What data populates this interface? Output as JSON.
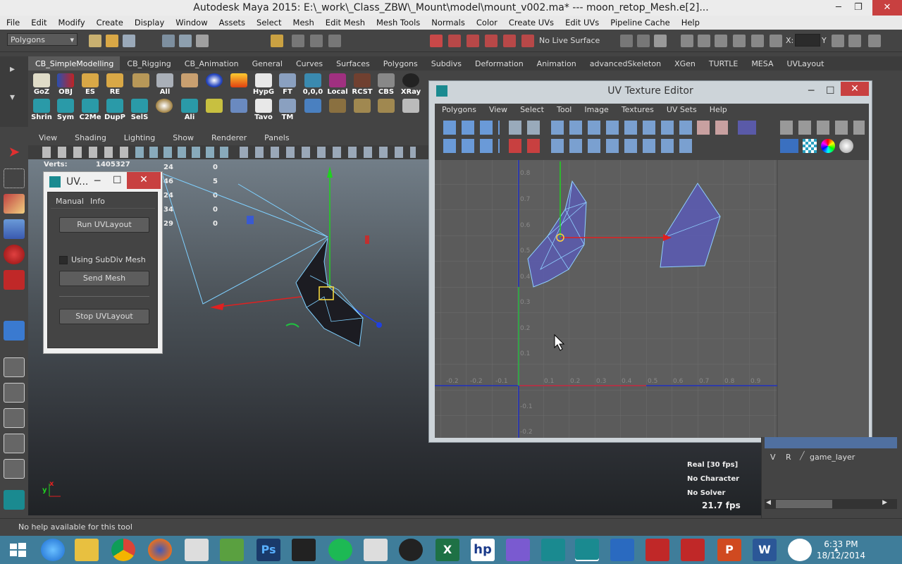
{
  "window": {
    "title": "Autodesk Maya 2015: E:\\_work\\_Class_ZBW\\_Mount\\model\\mount_v002.ma*   ---   moon_retop_Mesh.e[2]..."
  },
  "menubar": [
    "File",
    "Edit",
    "Modify",
    "Create",
    "Display",
    "Window",
    "Assets",
    "Select",
    "Mesh",
    "Edit Mesh",
    "Mesh Tools",
    "Normals",
    "Color",
    "Create UVs",
    "Edit UVs",
    "Pipeline Cache",
    "Help"
  ],
  "statusline": {
    "menuset": "Polygons",
    "live_surface": "No Live Surface",
    "x_label": "X:",
    "y_label": "Y"
  },
  "shelf_tabs": [
    "CB_SimpleModelling",
    "CB_Rigging",
    "CB_Animation",
    "General",
    "Curves",
    "Surfaces",
    "Polygons",
    "Subdivs",
    "Deformation",
    "Animation",
    "advancedSkeleton",
    "XGen",
    "TURTLE",
    "MESA",
    "UVLayout"
  ],
  "shelf_row1": [
    "GoZ",
    "OBJ",
    "ES",
    "RE",
    "",
    "All",
    "",
    "",
    "HypG",
    "FT",
    "0,0,0",
    "Local",
    "RCST",
    "CBS",
    "XRay"
  ],
  "shelf_row2": [
    "Shrin",
    "Sym",
    "C2Me",
    "DupP",
    "SelS",
    "",
    "Ali",
    "",
    "",
    "Tavo",
    "TM",
    "",
    "",
    "",
    ""
  ],
  "viewport": {
    "menu": [
      "View",
      "Shading",
      "Lighting",
      "Show",
      "Renderer",
      "Panels"
    ],
    "hud_label": "Verts:",
    "hud_value": "1405327",
    "hud_col1": [
      "24",
      "46",
      "24",
      "34",
      "29"
    ],
    "hud_col2": [
      "0",
      "5",
      "0",
      "0",
      "0"
    ],
    "fps_rows": [
      "Real [30 fps]",
      "No Character",
      "No Solver"
    ],
    "fps": "21.7 fps",
    "axis_x": "x",
    "axis_y": "y"
  },
  "uvlayout_window": {
    "title": "UV...",
    "menu": [
      "Manual",
      "Info"
    ],
    "run": "Run UVLayout",
    "subdiv": "Using SubDiv Mesh",
    "send": "Send Mesh",
    "stop": "Stop UVLayout"
  },
  "uv_editor": {
    "title": "UV Texture Editor",
    "menu": [
      "Polygons",
      "View",
      "Select",
      "Tool",
      "Image",
      "Textures",
      "UV Sets",
      "Help"
    ],
    "u_ticks": [
      "-0.2",
      "-0.1",
      "0.1",
      "0.2",
      "0.3",
      "0.4",
      "0.5",
      "0.6",
      "0.7",
      "0.8",
      "0.9"
    ],
    "v_ticks": [
      "0.8",
      "0.7",
      "0.6",
      "0.5",
      "0.4",
      "0.3",
      "0.2",
      "0.1",
      "-0.1",
      "-0.2"
    ]
  },
  "layers": [
    {
      "v": "V",
      "r": "R",
      "name": "game_layer"
    }
  ],
  "help_line": "No help available for this tool",
  "taskbar": {
    "time": "6:33 PM",
    "date": "18/12/2014"
  },
  "colors": {
    "maya_bg": "#444444",
    "taskbar": "#3f7d9a",
    "uv_shell": "#5a5ab5",
    "wire": "#7fd0ff"
  }
}
